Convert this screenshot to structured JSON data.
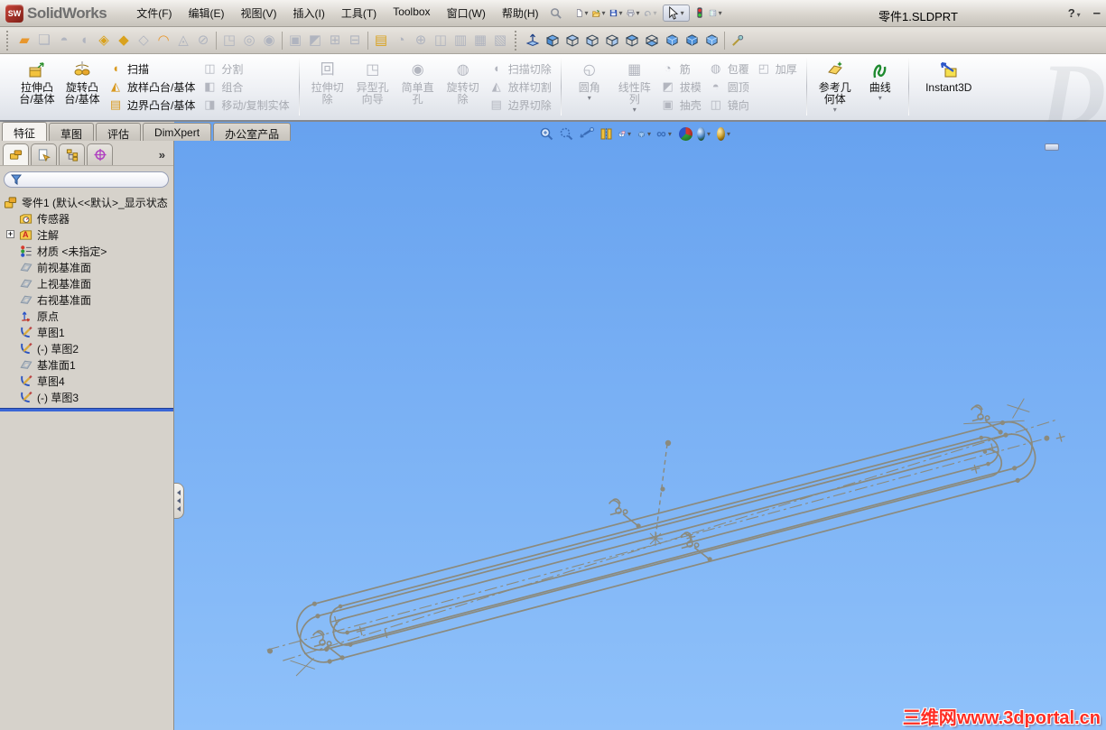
{
  "window": {
    "logo": "SW",
    "brand": "SolidWorks",
    "doc_title": "零件1.SLDPRT",
    "help_glyph": "?",
    "minimize_glyph": "–"
  },
  "menus": [
    "文件(F)",
    "编辑(E)",
    "视图(V)",
    "插入(I)",
    "工具(T)",
    "Toolbox",
    "窗口(W)",
    "帮助(H)"
  ],
  "command_tabs": [
    "特征",
    "草图",
    "评估",
    "DimXpert",
    "办公室产品"
  ],
  "ribbon": {
    "extrude_boss": "拉伸凸台/基体",
    "revolve_boss": "旋转凸台/基体",
    "sweep": "扫描",
    "loft": "放样凸台/基体",
    "boundary": "边界凸台/基体",
    "split": "分割",
    "combine": "组合",
    "move_copy": "移动/复制实体",
    "extruded_cut": "拉伸切除",
    "hole_wizard": "异型孔向导",
    "simple_hole": "简单直孔",
    "revolved_cut": "旋转切除",
    "swept_cut": "扫描切除",
    "lofted_cut": "放样切割",
    "boundary_cut": "边界切除",
    "fillet": "圆角",
    "linear_pattern": "线性阵列",
    "rib": "筋",
    "draft": "拔模",
    "shell": "抽壳",
    "wrap": "包覆",
    "dome": "圆顶",
    "mirror": "镜向",
    "thicken": "加厚",
    "reference_geometry": "参考几何体",
    "curves": "曲线",
    "instant3d": "Instant3D"
  },
  "feature_tree": {
    "root": "零件1 (默认<<默认>_显示状态",
    "items": [
      "传感器",
      "注解",
      "材质 <未指定>",
      "前视基准面",
      "上视基准面",
      "右视基准面",
      "原点",
      "草图1",
      "(-) 草图2",
      "基准面1",
      "草图4",
      "(-) 草图3"
    ]
  },
  "glyphs": {
    "annotation_letter": "A",
    "chevrons": "»",
    "expand_plus": "+"
  },
  "viewport": {
    "watermark": "三维网www.3dportal.cn",
    "brand_watermark": "D"
  },
  "colors": {
    "viewport_top": "#67a2ef",
    "viewport_bottom": "#8fc1fa",
    "sketch_stroke": "#8b8a7d",
    "accent_gold": "#f0b63c",
    "watermark_red": "#ff2d23",
    "rollback_blue": "#3a66d6"
  }
}
